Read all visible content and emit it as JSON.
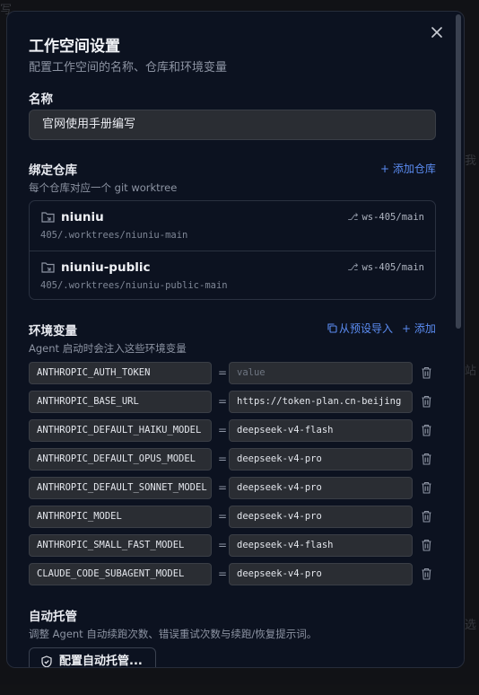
{
  "background": {
    "frag_top": "写",
    "frag_right_1": "我",
    "frag_right_2": "站",
    "frag_right_3": "选",
    "frag_left": "丨"
  },
  "modal": {
    "title": "工作空间设置",
    "subtitle": "配置工作空间的名称、仓库和环境变量",
    "close_icon": "close-icon"
  },
  "name_section": {
    "label": "名称",
    "value": "官网使用手册编写"
  },
  "repo_section": {
    "label": "绑定仓库",
    "desc": "每个仓库对应一个 git worktree",
    "add_label": "+ 添加仓库",
    "repos": [
      {
        "name": "niuniu",
        "path": "405/.worktrees/niuniu-main",
        "branch": "ws-405/main"
      },
      {
        "name": "niuniu-public",
        "path": "405/.worktrees/niuniu-public-main",
        "branch": "ws-405/main"
      }
    ]
  },
  "env_section": {
    "label": "环境变量",
    "desc": "Agent 启动时会注入这些环境变量",
    "import_label": "从预设导入",
    "add_label": "+ 添加",
    "vars": [
      {
        "key": "ANTHROPIC_AUTH_TOKEN",
        "value": "",
        "placeholder": "value"
      },
      {
        "key": "ANTHROPIC_BASE_URL",
        "value": "https://token-plan.cn-beijing",
        "placeholder": ""
      },
      {
        "key": "ANTHROPIC_DEFAULT_HAIKU_MODEL",
        "value": "deepseek-v4-flash",
        "placeholder": ""
      },
      {
        "key": "ANTHROPIC_DEFAULT_OPUS_MODEL",
        "value": "deepseek-v4-pro",
        "placeholder": ""
      },
      {
        "key": "ANTHROPIC_DEFAULT_SONNET_MODEL",
        "value": "deepseek-v4-pro",
        "placeholder": ""
      },
      {
        "key": "ANTHROPIC_MODEL",
        "value": "deepseek-v4-pro",
        "placeholder": ""
      },
      {
        "key": "ANTHROPIC_SMALL_FAST_MODEL",
        "value": "deepseek-v4-flash",
        "placeholder": ""
      },
      {
        "key": "CLAUDE_CODE_SUBAGENT_MODEL",
        "value": "deepseek-v4-pro",
        "placeholder": ""
      }
    ]
  },
  "auto_section": {
    "label": "自动托管",
    "desc": "调整 Agent 自动续跑次数、错误重试次数与续跑/恢复提示词。",
    "button_label": "配置自动托管..."
  },
  "colors": {
    "accent": "#5b8cf2",
    "modal_bg": "#0c1220",
    "input_bg": "#2a2d33"
  }
}
